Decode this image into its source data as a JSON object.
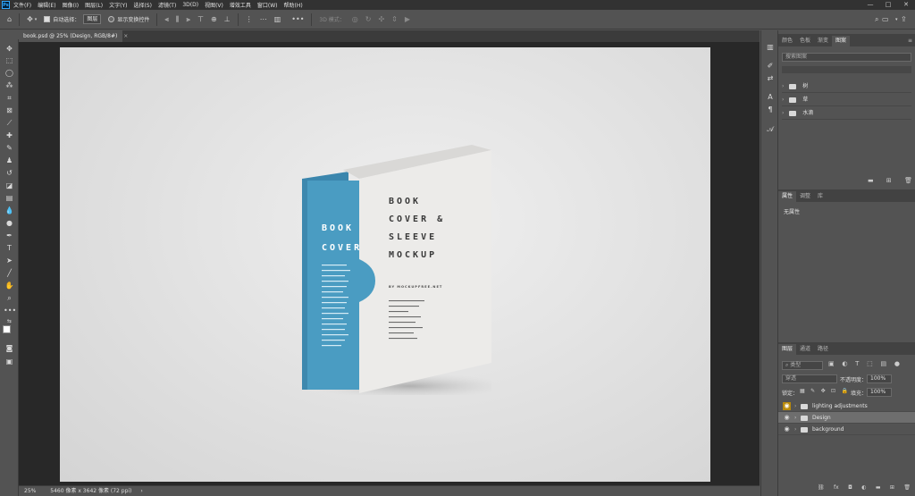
{
  "menubar": {
    "app_icon": "Ps",
    "items": [
      "文件(F)",
      "编辑(E)",
      "图像(I)",
      "图层(L)",
      "文字(Y)",
      "选择(S)",
      "滤镜(T)",
      "3D(D)",
      "视图(V)",
      "增效工具",
      "窗口(W)",
      "帮助(H)"
    ],
    "window_buttons": [
      "—",
      "□",
      "✕"
    ]
  },
  "optbar": {
    "auto_select_label": "自动选择：",
    "auto_select_value": "图层",
    "transform_label": "显示变换控件",
    "mode_3d_label": "3D 模式："
  },
  "tab": {
    "title": "book.psd @ 25% (Design, RGB/8#)",
    "close": "×"
  },
  "status": {
    "zoom": "25%",
    "doc_size": "5460 像素 x 3642 像素 (72 ppi)",
    "arrow": "›"
  },
  "book": {
    "spine_title": [
      "BOOK",
      "COVER"
    ],
    "cover_title": [
      "BOOK",
      "COVER &",
      "SLEEVE",
      "MOCKUP"
    ],
    "cover_sub": "BY MOCKUPFREE.NET"
  },
  "panel_top": {
    "tabs": [
      "颜色",
      "色板",
      "渐变",
      "图案"
    ],
    "search_placeholder": "搜索图案",
    "items": [
      "树",
      "草",
      "水滴"
    ]
  },
  "panel_props": {
    "tabs": [
      "属性",
      "调整",
      "库"
    ],
    "empty_text": "无属性"
  },
  "panel_layers": {
    "tabs": [
      "图层",
      "通道",
      "路径"
    ],
    "filter_label": "类型",
    "blend_mode": "穿透",
    "opacity_label": "不透明度：",
    "opacity_value": "100%",
    "lock_label": "锁定：",
    "fill_label": "填充：",
    "fill_value": "100%",
    "layers": [
      {
        "name": "lighting adjustments",
        "selected": false
      },
      {
        "name": "Design",
        "selected": true
      },
      {
        "name": "background",
        "selected": false
      }
    ],
    "footer_icons": [
      "link-icon",
      "fx-icon",
      "mask-icon",
      "adjustment-icon",
      "folder-icon",
      "new-layer-icon",
      "trash-icon"
    ]
  },
  "colors": {
    "accent": "#31a8ff",
    "book_blue": "#4a9cc2",
    "eye_highlight": "#b8890b"
  }
}
